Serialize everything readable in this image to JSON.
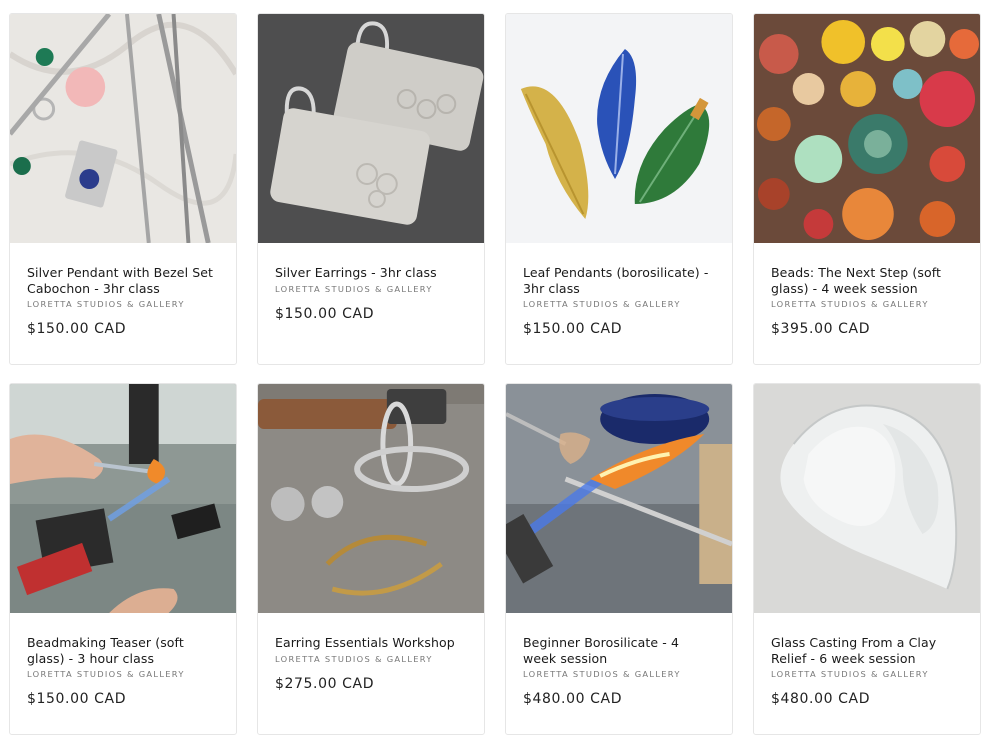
{
  "products": [
    {
      "title": "Silver Pendant with Bezel Set Cabochon - 3hr class",
      "vendor": "LORETTA STUDIOS & GALLERY",
      "price": "$150.00 CAD",
      "image_icon": "silver-pendant-photo"
    },
    {
      "title": "Silver Earrings - 3hr class",
      "vendor": "LORETTA STUDIOS & GALLERY",
      "price": "$150.00 CAD",
      "image_icon": "silver-earrings-photo"
    },
    {
      "title": "Leaf Pendants (borosilicate) - 3hr class",
      "vendor": "LORETTA STUDIOS & GALLERY",
      "price": "$150.00 CAD",
      "image_icon": "glass-leaf-pendants-photo"
    },
    {
      "title": "Beads: The Next Step (soft glass) - 4 week session",
      "vendor": "LORETTA STUDIOS & GALLERY",
      "price": "$395.00 CAD",
      "image_icon": "glass-beads-photo"
    },
    {
      "title": "Beadmaking Teaser (soft glass) - 3 hour class",
      "vendor": "LORETTA STUDIOS & GALLERY",
      "price": "$150.00 CAD",
      "image_icon": "torch-beadmaking-photo"
    },
    {
      "title": "Earring Essentials Workshop",
      "vendor": "LORETTA STUDIOS & GALLERY",
      "price": "$275.00 CAD",
      "image_icon": "metal-earrings-photo"
    },
    {
      "title": "Beginner Borosilicate - 4 week session",
      "vendor": "LORETTA STUDIOS & GALLERY",
      "price": "$480.00 CAD",
      "image_icon": "borosilicate-torch-photo"
    },
    {
      "title": "Glass Casting From a Clay Relief - 6 week session",
      "vendor": "LORETTA STUDIOS & GALLERY",
      "price": "$480.00 CAD",
      "image_icon": "cast-glass-photo"
    }
  ],
  "colors": {
    "card_border": "#e6e6e6",
    "title_text": "#1a1a1a",
    "vendor_text": "#777777",
    "price_text": "#222222"
  }
}
